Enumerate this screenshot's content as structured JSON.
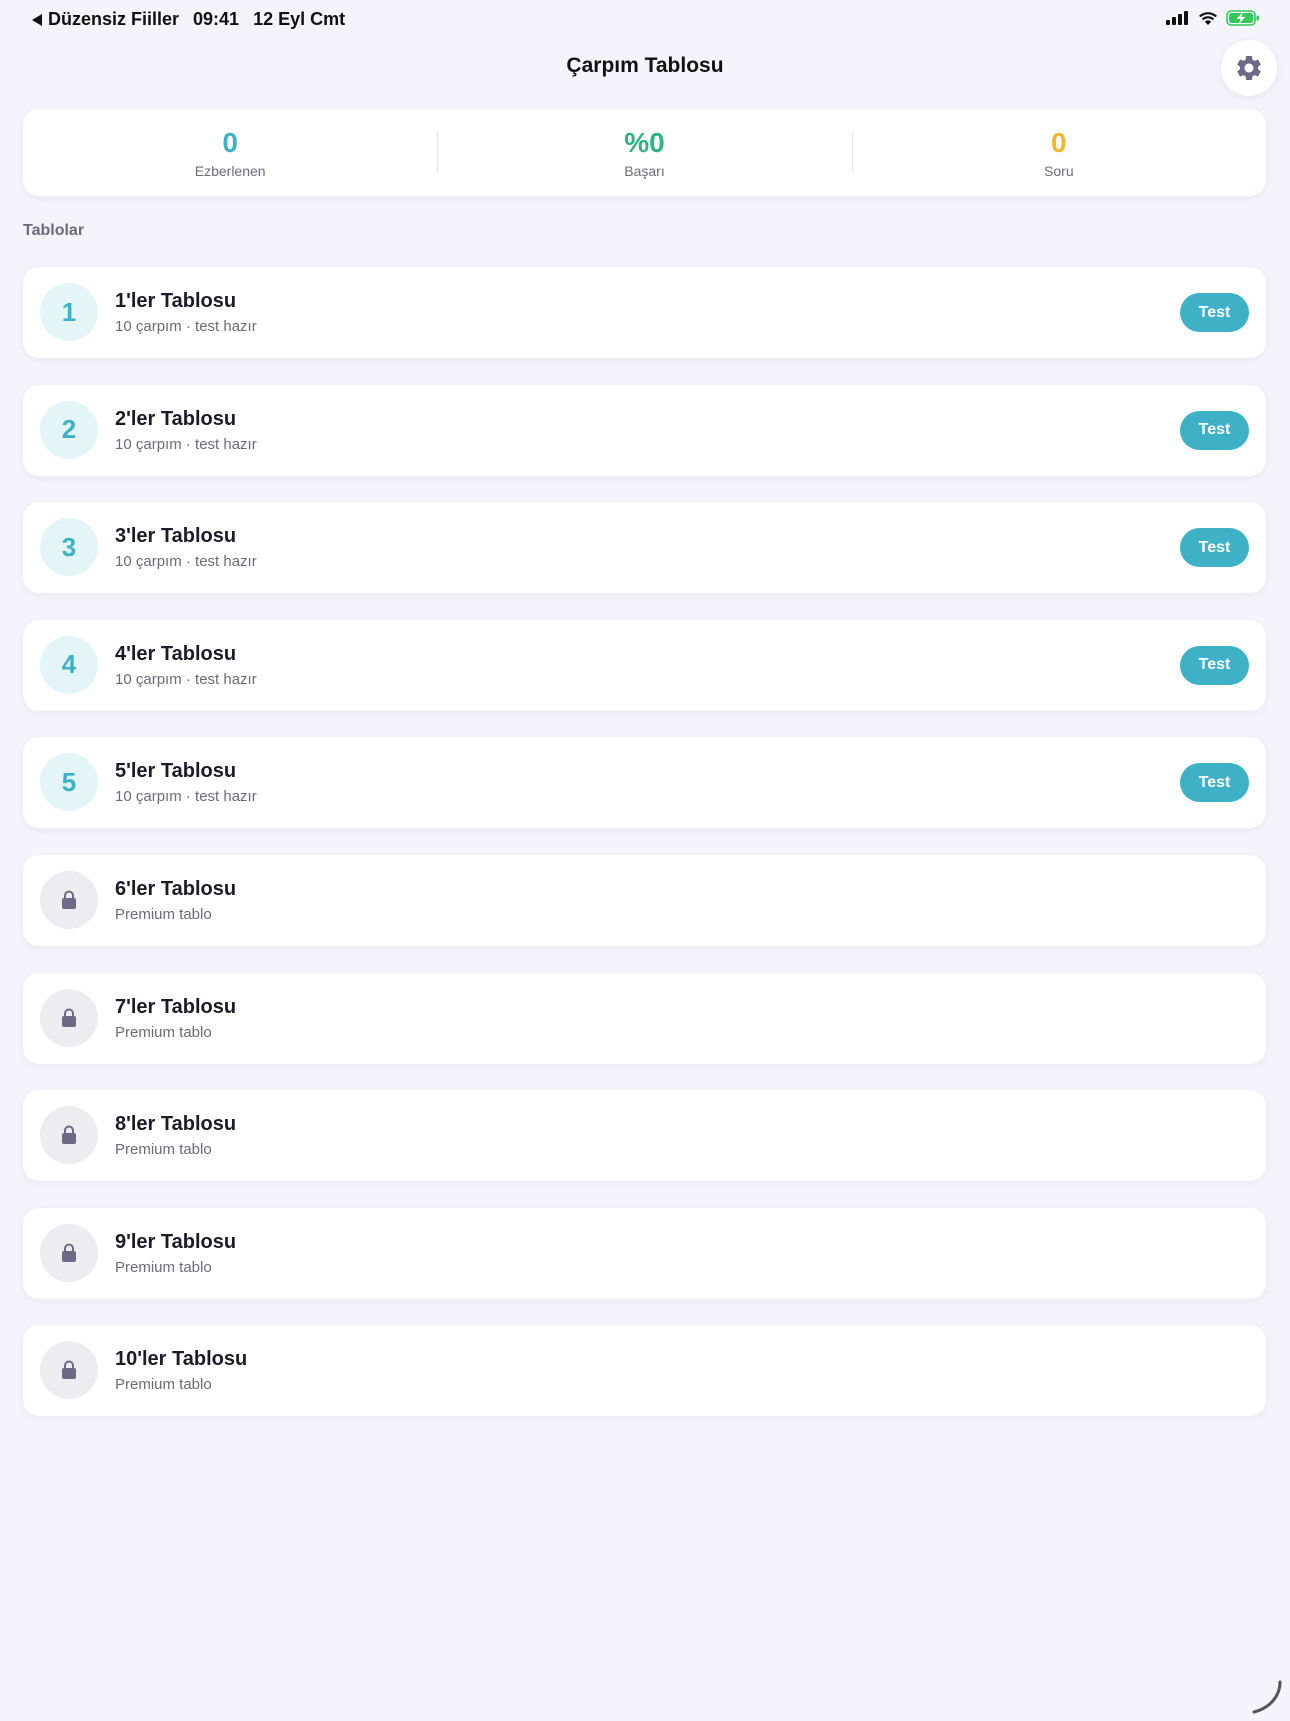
{
  "status_bar": {
    "back_app": "Düzensiz Fiiller",
    "time": "09:41",
    "date": "12 Eyl Cmt"
  },
  "header": {
    "title": "Çarpım Tablosu",
    "settings_icon": "gear-icon"
  },
  "stats": [
    {
      "value": "0",
      "label": "Ezberlenen",
      "color": "#3fb1c6"
    },
    {
      "value": "%0",
      "label": "Başarı",
      "color": "#2fb381"
    },
    {
      "value": "0",
      "label": "Soru",
      "color": "#f2b532"
    }
  ],
  "section_title": "Tablolar",
  "tables": [
    {
      "badge": "1",
      "title": "1'ler Tablosu",
      "subtitle": "10 çarpım · test hazır",
      "action": "Test",
      "locked": false
    },
    {
      "badge": "2",
      "title": "2'ler Tablosu",
      "subtitle": "10 çarpım · test hazır",
      "action": "Test",
      "locked": false
    },
    {
      "badge": "3",
      "title": "3'ler Tablosu",
      "subtitle": "10 çarpım · test hazır",
      "action": "Test",
      "locked": false
    },
    {
      "badge": "4",
      "title": "4'ler Tablosu",
      "subtitle": "10 çarpım · test hazır",
      "action": "Test",
      "locked": false
    },
    {
      "badge": "5",
      "title": "5'ler Tablosu",
      "subtitle": "10 çarpım · test hazır",
      "action": "Test",
      "locked": false
    },
    {
      "badge": "",
      "title": "6'ler Tablosu",
      "subtitle": "Premium tablo",
      "action": "",
      "locked": true
    },
    {
      "badge": "",
      "title": "7'ler Tablosu",
      "subtitle": "Premium tablo",
      "action": "",
      "locked": true
    },
    {
      "badge": "",
      "title": "8'ler Tablosu",
      "subtitle": "Premium tablo",
      "action": "",
      "locked": true
    },
    {
      "badge": "",
      "title": "9'ler Tablosu",
      "subtitle": "Premium tablo",
      "action": "",
      "locked": true
    },
    {
      "badge": "",
      "title": "10'ler Tablosu",
      "subtitle": "Premium tablo",
      "action": "",
      "locked": true
    }
  ],
  "colors": {
    "accent": "#3fb1c6",
    "lock_icon": "#6e6a85",
    "background": "#f4f4fc"
  }
}
